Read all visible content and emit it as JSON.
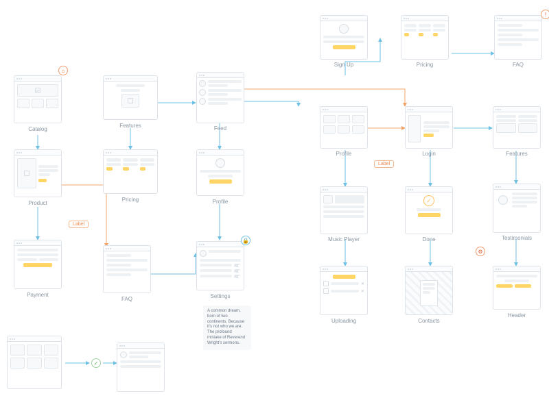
{
  "labels": {
    "catalog": "Catalog",
    "features": "Features",
    "feed": "Feed",
    "signup": "Sign Up",
    "pricing": "Pricing",
    "faq": "FAQ",
    "product": "Product",
    "profile": "Profile",
    "login": "Login",
    "features2": "Features",
    "musicplayer": "Music Player",
    "done": "Done",
    "testimonials": "Testimonials",
    "payment": "Payment",
    "faq2": "FAQ",
    "settings": "Settings",
    "uploading": "Uploading",
    "contacts": "Contacts",
    "header": "Header",
    "pricing2": "Pricing",
    "profile2": "Profile"
  },
  "badges": {
    "label1": "Label",
    "label2": "Label"
  },
  "note": "A common dream, born of two continents. Because it's not who we are. The profound mistake of Reverend Wright's sermons."
}
